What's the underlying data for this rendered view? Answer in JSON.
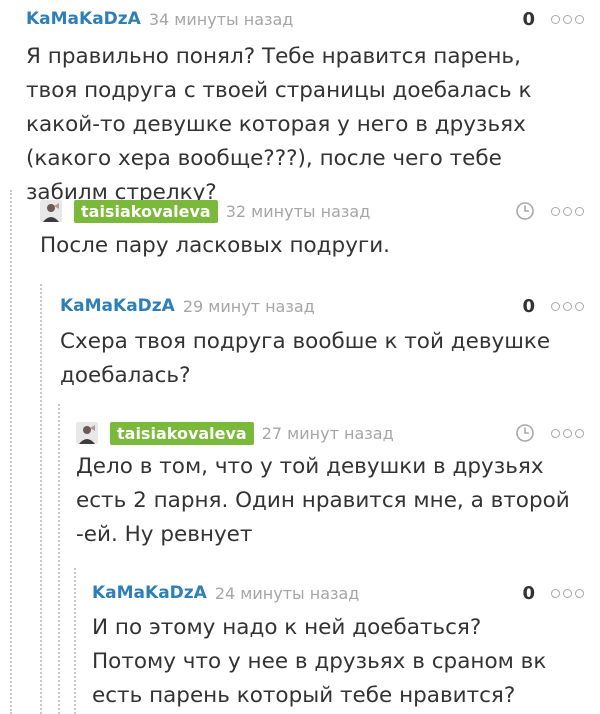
{
  "comments": [
    {
      "author": "KaMaKaDzA",
      "time": "34 минуты назад",
      "rating": "0",
      "text": "Я правильно понял? Тебе нравится парень, твоя подруга с твоей страницы доебалась к какой-то девушке которая у него в друзьях (какого хера вообще???), после чего тебе забилм стрелку?"
    },
    {
      "author": "taisiakovaleva",
      "time": "32 минуты назад",
      "text": "После пару ласковых подруги."
    },
    {
      "author": "KaMaKaDzA",
      "time": "29 минут назад",
      "rating": "0",
      "text": "Схера твоя подруга вообше к той девушке доебалась?"
    },
    {
      "author": "taisiakovaleva",
      "time": "27 минут назад",
      "text": "Дело в том, что у той девушки в друзьях есть 2 парня. Один нравится мне, а второй -ей. Ну ревнует"
    },
    {
      "author": "KaMaKaDzA",
      "time": "24 минуты назад",
      "rating": "0",
      "text": "И по этому надо к ней доебаться? Потому что у нее в друзьях в сраном вк есть парень который тебе нравится?"
    }
  ],
  "colors": {
    "author_link": "#2e7fb8",
    "op_badge": "#7bb93b",
    "timestamp": "#a6a6a6",
    "text": "#333333",
    "thread_guide": "#c9c9c9"
  }
}
